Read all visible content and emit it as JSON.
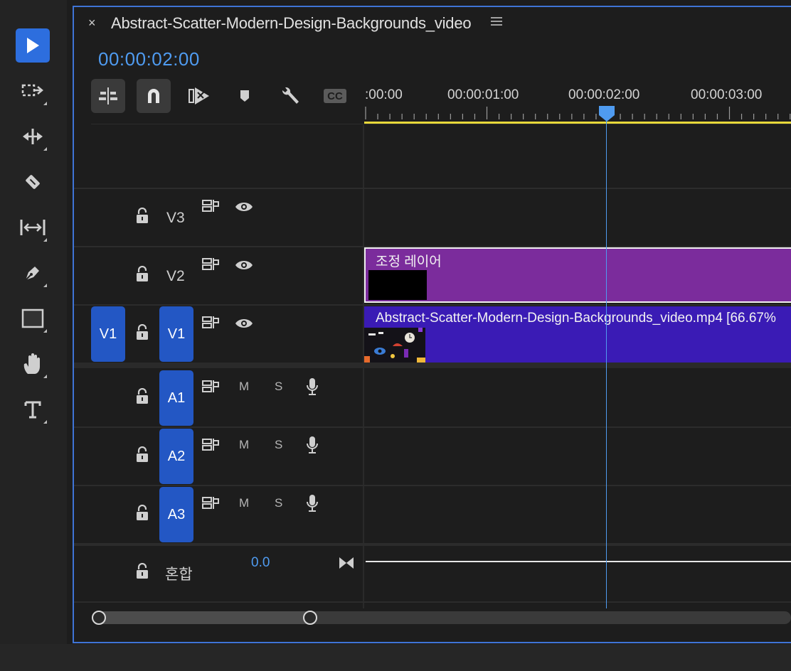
{
  "panel": {
    "close_glyph": "×",
    "title": "Abstract-Scatter-Modern-Design-Backgrounds_video",
    "timecode": "00:00:02:00"
  },
  "tools": [
    {
      "name": "selection-tool",
      "icon": "arrow-icon",
      "active": true
    },
    {
      "name": "track-select-tool",
      "icon": "track-select-icon"
    },
    {
      "name": "ripple-edit-tool",
      "icon": "ripple-edit-icon"
    },
    {
      "name": "razor-tool",
      "icon": "razor-icon"
    },
    {
      "name": "slip-tool",
      "icon": "slip-icon"
    },
    {
      "name": "pen-tool",
      "icon": "pen-icon"
    },
    {
      "name": "rectangle-tool",
      "icon": "rectangle-icon"
    },
    {
      "name": "hand-tool",
      "icon": "hand-icon"
    },
    {
      "name": "type-tool",
      "icon": "type-icon"
    }
  ],
  "timeline_toolbar": [
    "insert-sequence-icon",
    "snap-magnet-icon",
    "linked-selection-icon",
    "add-marker-icon",
    "settings-wrench-icon",
    "captions-icon"
  ],
  "toolbar": {
    "captions_label": "CC"
  },
  "ruler": {
    "labels": [
      ":00:00",
      "00:00:01:00",
      "00:00:02:00",
      "00:00:03:00"
    ]
  },
  "tracks": {
    "video": [
      {
        "name": "V3",
        "source": ""
      },
      {
        "name": "V2",
        "source": ""
      },
      {
        "name": "V1",
        "source": "V1"
      }
    ],
    "audio": [
      {
        "name": "A1",
        "m": "M",
        "s": "S"
      },
      {
        "name": "A2",
        "m": "M",
        "s": "S"
      },
      {
        "name": "A3",
        "m": "M",
        "s": "S"
      }
    ],
    "mix": {
      "name": "혼합",
      "value": "0.0"
    }
  },
  "clips": {
    "v2": {
      "title": "조정 레이어"
    },
    "v1": {
      "title": "Abstract-Scatter-Modern-Design-Backgrounds_video.mp4 [66.67%"
    }
  },
  "colors": {
    "accent": "#2d6ede",
    "timecode": "#4f9bf0",
    "adjustment_clip": "#7b2c9c",
    "video_clip": "#3a1bb5",
    "track_chip": "#2357c4",
    "work_area": "#e8d83a"
  }
}
